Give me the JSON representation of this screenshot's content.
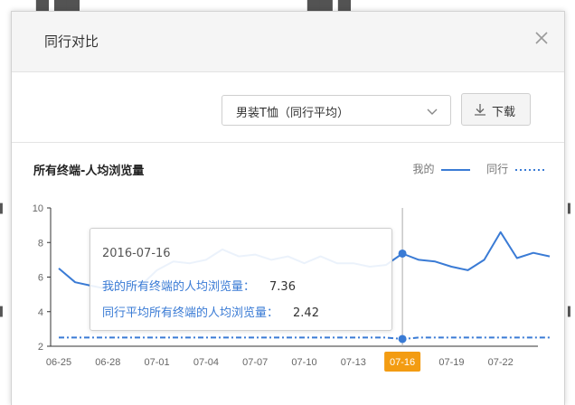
{
  "modal": {
    "title": "同行对比",
    "close_icon": "close-icon"
  },
  "toolbar": {
    "select_value": "男装T恤（同行平均）",
    "download_label": "下载"
  },
  "panel": {
    "title": "所有终端-人均浏览量",
    "legend": [
      {
        "name": "我的",
        "style": "solid"
      },
      {
        "name": "同行",
        "style": "dotted"
      }
    ]
  },
  "tooltip": {
    "date": "2016-07-16",
    "rows": [
      {
        "label": "我的所有终端的人均浏览量：",
        "value": "7.36"
      },
      {
        "label": "同行平均所有终端的人均浏览量：",
        "value": "2.42"
      }
    ]
  },
  "colors": {
    "series": "#3a7bd5",
    "highlight": "#f39c12"
  },
  "chart_data": {
    "type": "line",
    "x": [
      "06-25",
      "06-26",
      "06-27",
      "06-28",
      "06-29",
      "06-30",
      "07-01",
      "07-02",
      "07-03",
      "07-04",
      "07-05",
      "07-06",
      "07-07",
      "07-08",
      "07-09",
      "07-10",
      "07-11",
      "07-12",
      "07-13",
      "07-14",
      "07-15",
      "07-16",
      "07-17",
      "07-18",
      "07-19",
      "07-20",
      "07-21",
      "07-22",
      "07-23",
      "07-24",
      "07-25"
    ],
    "x_tick_labels": [
      "06-25",
      "06-28",
      "07-01",
      "07-04",
      "07-07",
      "07-10",
      "07-13",
      "07-16",
      "07-19",
      "07-22"
    ],
    "highlight_x": "07-16",
    "ylim": [
      2,
      10
    ],
    "yticks": [
      2,
      4,
      6,
      8,
      10
    ],
    "grid": false,
    "legend_position": "top-right",
    "series": [
      {
        "name": "我的",
        "style": "solid",
        "values": [
          6.5,
          5.7,
          5.5,
          5.3,
          5.3,
          5.5,
          6.4,
          6.9,
          6.8,
          7.0,
          7.6,
          7.2,
          7.3,
          7.0,
          7.2,
          6.8,
          7.2,
          6.8,
          6.8,
          6.6,
          6.7,
          7.36,
          7.0,
          6.9,
          6.6,
          6.4,
          7.0,
          8.6,
          7.1,
          7.4,
          7.2
        ]
      },
      {
        "name": "同行",
        "style": "dotted",
        "values": [
          2.5,
          2.5,
          2.5,
          2.5,
          2.5,
          2.5,
          2.5,
          2.5,
          2.5,
          2.5,
          2.5,
          2.5,
          2.5,
          2.5,
          2.5,
          2.5,
          2.5,
          2.5,
          2.5,
          2.5,
          2.5,
          2.42,
          2.5,
          2.5,
          2.5,
          2.5,
          2.5,
          2.5,
          2.5,
          2.5,
          2.5
        ]
      }
    ]
  }
}
